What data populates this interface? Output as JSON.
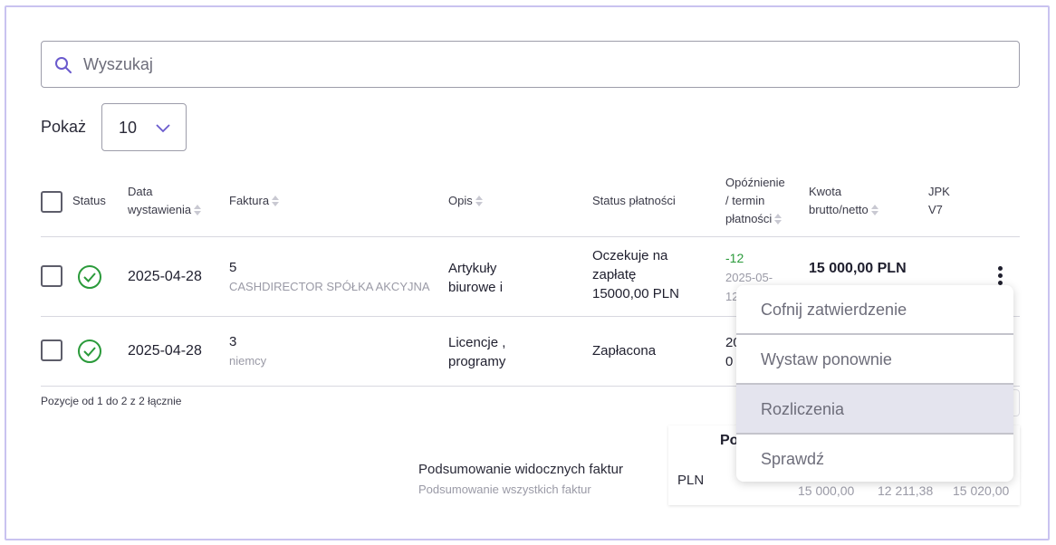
{
  "search": {
    "placeholder": "Wyszukaj"
  },
  "page_size": {
    "label": "Pokaż",
    "value": "10"
  },
  "table": {
    "headers": {
      "status": "Status",
      "date_line1": "Data",
      "date_line2": "wystawienia",
      "invoice": "Faktura",
      "desc": "Opis",
      "payment_status": "Status płatności",
      "delay_line1": "Opóźnienie",
      "delay_line2": "/ termin",
      "delay_line3": "płatności",
      "amount_line1": "Kwota",
      "amount_line2": "brutto/netto",
      "jpk_line1": "JPK",
      "jpk_line2": "V7"
    },
    "rows": [
      {
        "date": "2025-04-28",
        "invoice_no": "5",
        "client": "CASHDIRECTOR SPÓŁKA AKCYJNA",
        "desc_line1": "Artykuły",
        "desc_line2": "biurowe i",
        "payment_line1": "Oczekuje na",
        "payment_line2": "zapłatę",
        "payment_line3": "15000,00 PLN",
        "delay": "-12",
        "due_line1": "2025-05-",
        "due_line2": "12",
        "amount": "15 000,00 PLN"
      },
      {
        "date": "2025-04-28",
        "invoice_no": "3",
        "client": "niemcy",
        "desc_line1": "Licencje ,",
        "desc_line2": "programy",
        "payment_line1": "Zapłacona",
        "delay_line1": "20",
        "delay_line2": "0"
      }
    ],
    "footer_count": "Pozycje od 1 do 2 z 2 łącznie"
  },
  "summary": {
    "visible_label": "Podsumowanie widocznych faktur",
    "all_label": "Podsumowanie wszystkich faktur",
    "box_header": "Po",
    "currency": "PLN",
    "values": [
      "15 000,00",
      "12 211,38",
      "15 020,00"
    ]
  },
  "context_menu": {
    "items": [
      "Cofnij zatwierdzenie",
      "Wystaw ponownie",
      "Rozliczenia",
      "Sprawdź"
    ],
    "active_index": 2
  },
  "colors": {
    "accent": "#6a5acd",
    "success": "#2a9a3a",
    "frame": "#c9c3f0",
    "menu_active": "#e4e4ee"
  }
}
